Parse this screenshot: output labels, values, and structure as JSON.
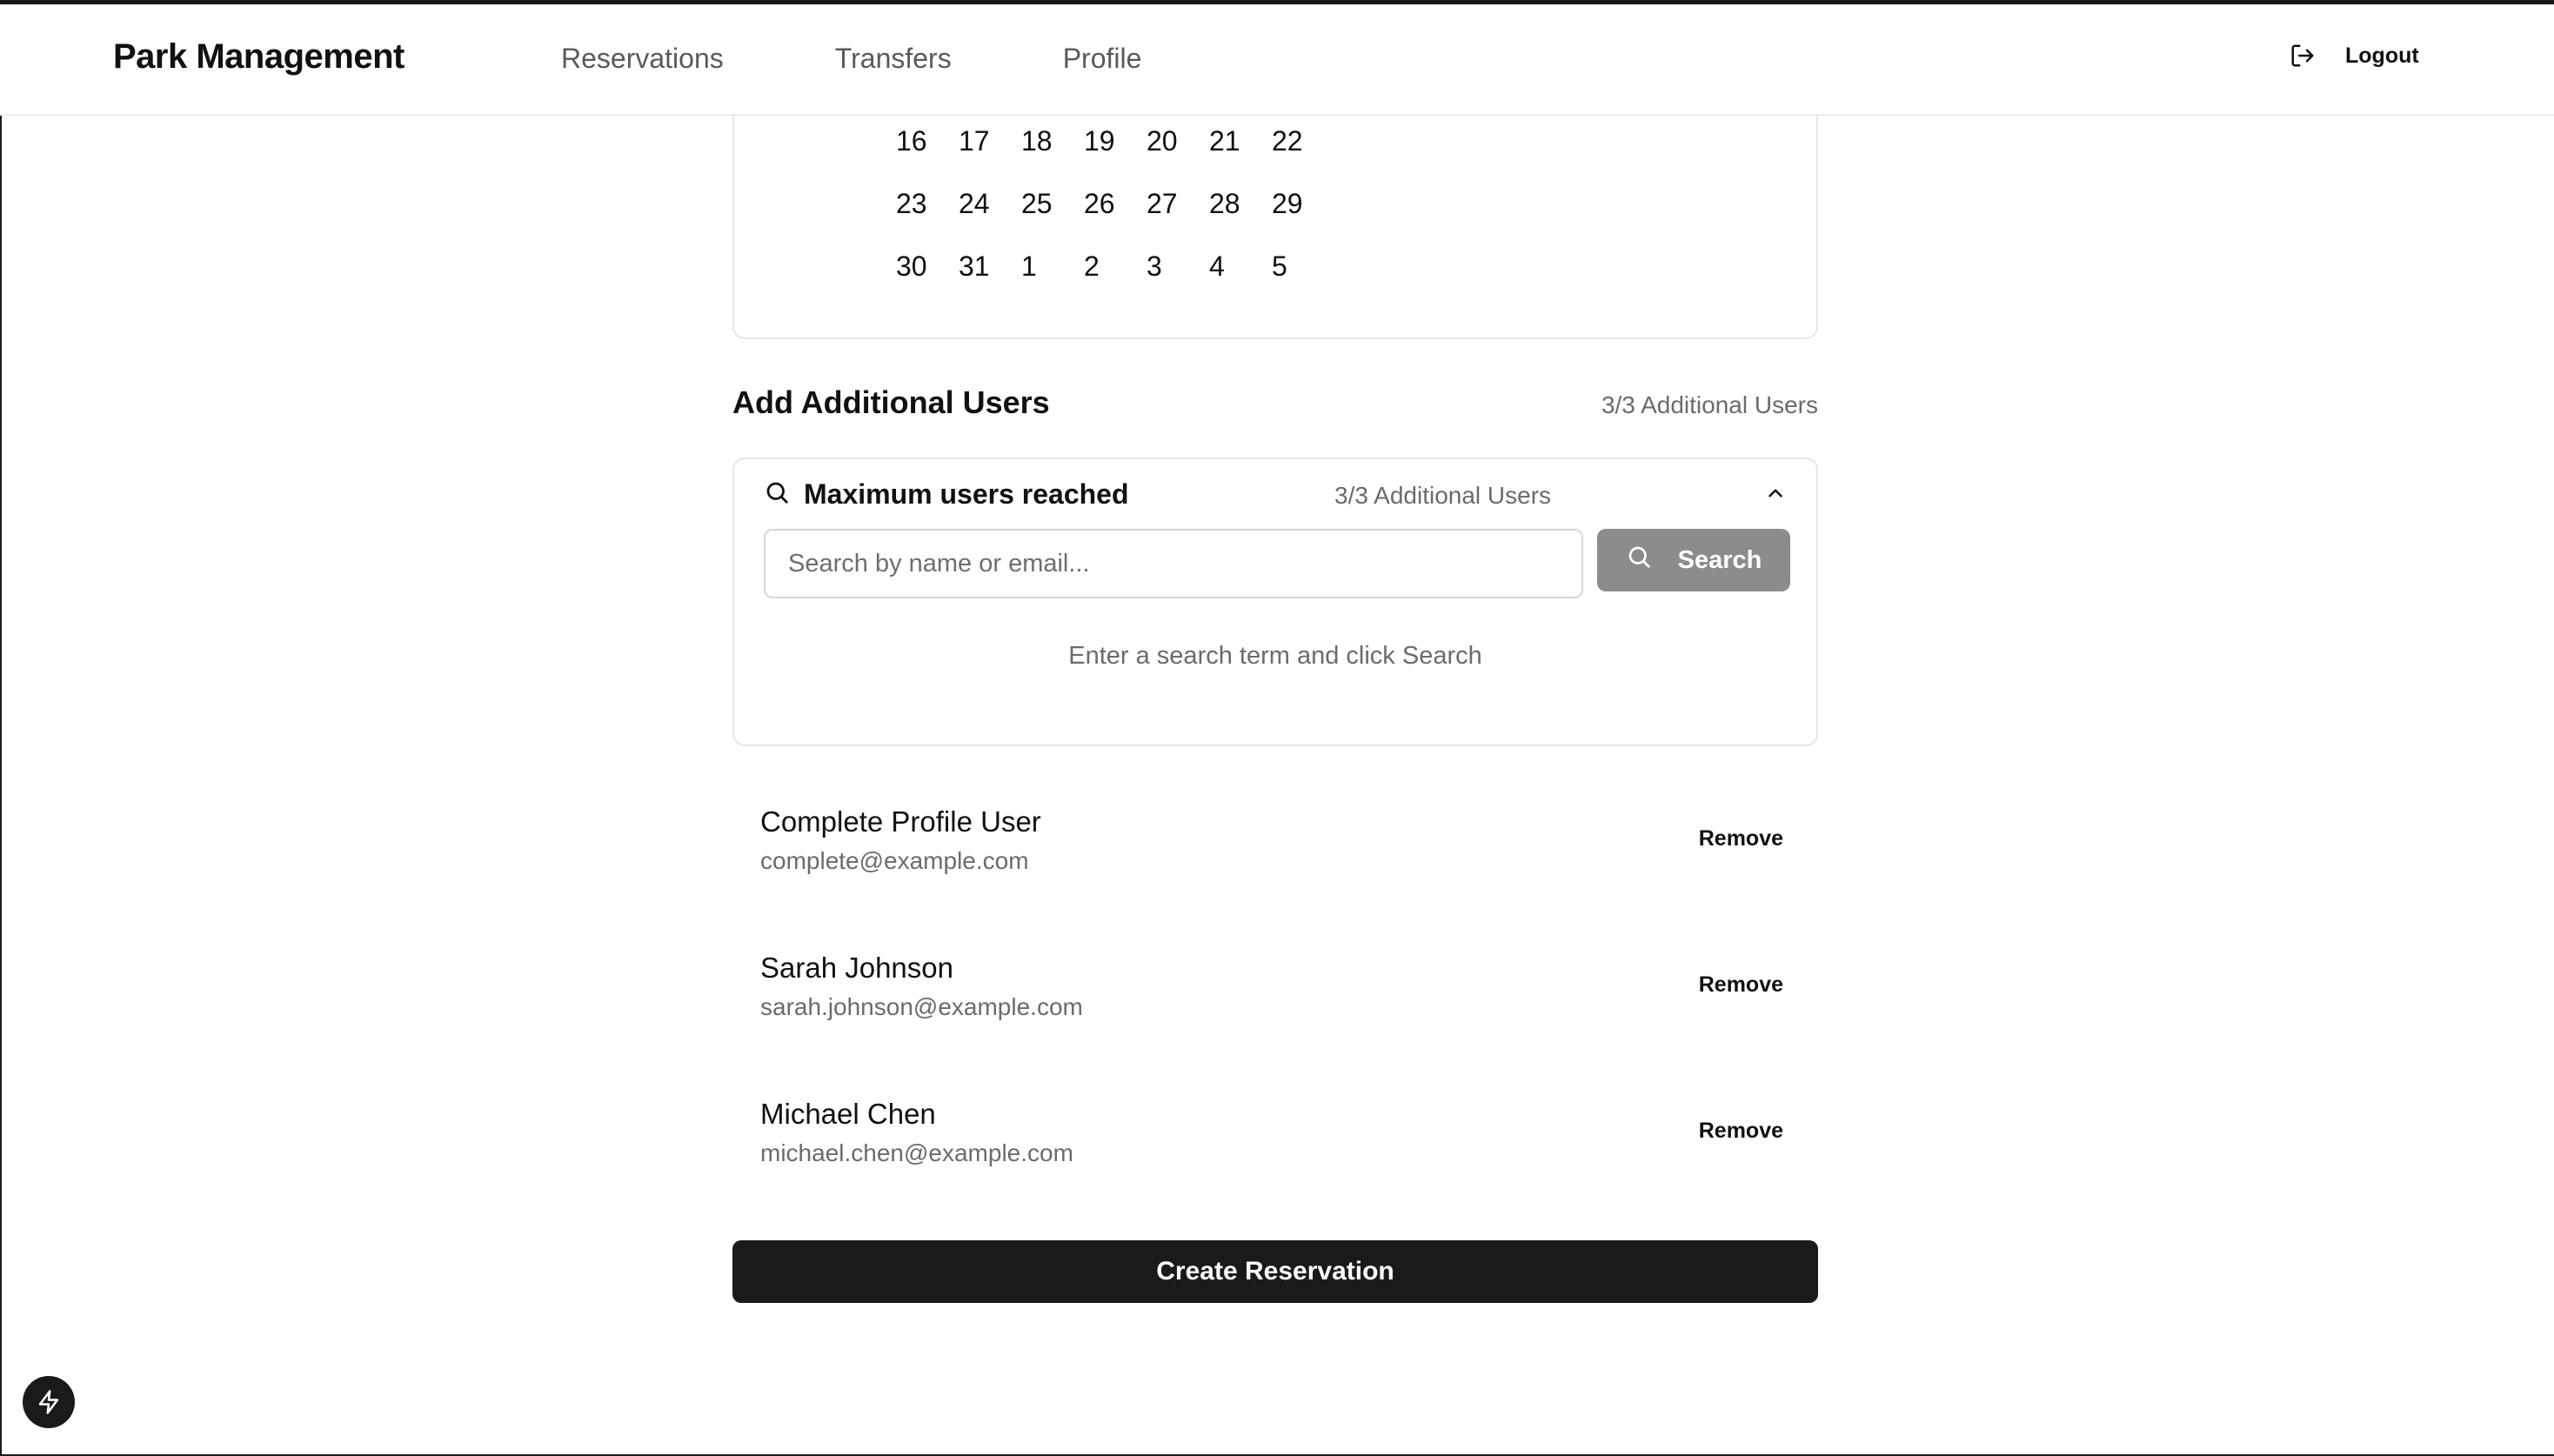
{
  "header": {
    "brand": "Park Management",
    "nav": [
      "Reservations",
      "Transfers",
      "Profile"
    ],
    "logout_label": "Logout"
  },
  "calendar": {
    "rows": [
      [
        "16",
        "17",
        "18",
        "19",
        "20",
        "21",
        "22"
      ],
      [
        "23",
        "24",
        "25",
        "26",
        "27",
        "28",
        "29"
      ],
      [
        "30",
        "31",
        "1",
        "2",
        "3",
        "4",
        "5"
      ]
    ]
  },
  "additional_users": {
    "title": "Add Additional Users",
    "count": "3/3 Additional Users",
    "search_panel": {
      "title": "Maximum users reached",
      "count": "3/3 Additional Users",
      "input_value": "",
      "input_placeholder": "Search by name or email...",
      "button_label": "Search",
      "hint": "Enter a search term and click Search"
    },
    "users": [
      {
        "name": "Complete Profile User",
        "email": "complete@example.com",
        "action": "Remove"
      },
      {
        "name": "Sarah Johnson",
        "email": "sarah.johnson@example.com",
        "action": "Remove"
      },
      {
        "name": "Michael Chen",
        "email": "michael.chen@example.com",
        "action": "Remove"
      }
    ]
  },
  "create_button_label": "Create Reservation",
  "icons": {
    "logout": "logout-icon",
    "search": "search-icon",
    "chevron": "chevron-up-icon",
    "fab": "lightning-icon"
  },
  "colors": {
    "primary": "#1a1a1a",
    "search_button": "#8c8c8c",
    "muted_text": "#6b6b6b",
    "border": "#e6e6e6"
  }
}
